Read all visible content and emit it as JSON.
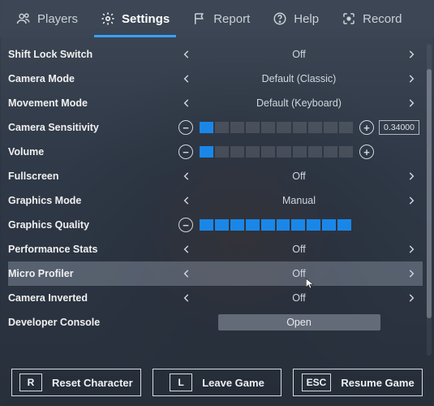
{
  "tabs": {
    "players": "Players",
    "settings": "Settings",
    "report": "Report",
    "help": "Help",
    "record": "Record",
    "activeIndex": 1
  },
  "settings": {
    "shiftLock": {
      "label": "Shift Lock Switch",
      "value": "Off"
    },
    "cameraMode": {
      "label": "Camera Mode",
      "value": "Default (Classic)"
    },
    "movementMode": {
      "label": "Movement Mode",
      "value": "Default (Keyboard)"
    },
    "cameraSens": {
      "label": "Camera Sensitivity",
      "value": 0.34,
      "display": "0.34000",
      "segs": 10,
      "fill": 1
    },
    "volume": {
      "label": "Volume",
      "segs": 10,
      "fill": 1
    },
    "fullscreen": {
      "label": "Fullscreen",
      "value": "Off"
    },
    "graphicsMode": {
      "label": "Graphics Mode",
      "value": "Manual"
    },
    "graphicsQual": {
      "label": "Graphics Quality",
      "segs": 10,
      "fill": 10
    },
    "perfStats": {
      "label": "Performance Stats",
      "value": "Off"
    },
    "microProf": {
      "label": "Micro Profiler",
      "value": "Off"
    },
    "cameraInv": {
      "label": "Camera Inverted",
      "value": "Off"
    },
    "devConsole": {
      "label": "Developer Console",
      "button": "Open"
    }
  },
  "footer": {
    "reset": {
      "key": "R",
      "label": "Reset Character"
    },
    "leave": {
      "key": "L",
      "label": "Leave Game"
    },
    "resume": {
      "key": "ESC",
      "label": "Resume Game"
    }
  },
  "colors": {
    "accent": "#38a0ff",
    "sliderFill": "#1a87e8"
  }
}
